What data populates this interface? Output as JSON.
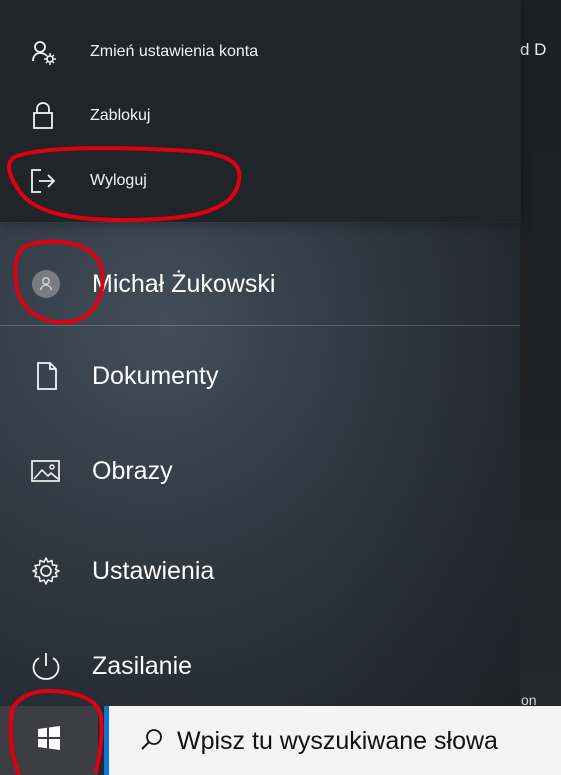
{
  "account_menu": {
    "items": [
      {
        "label": "Zmień ustawienia konta",
        "icon": "person-settings-icon"
      },
      {
        "label": "Zablokuj",
        "icon": "lock-icon"
      },
      {
        "label": "Wyloguj",
        "icon": "sign-out-icon"
      }
    ]
  },
  "fragments": {
    "top_right": "d D",
    "bottom_right": "on"
  },
  "start_menu": {
    "user": {
      "name": "Michał Żukowski",
      "icon": "avatar-icon"
    },
    "items": [
      {
        "label": "Dokumenty",
        "icon": "document-icon"
      },
      {
        "label": "Obrazy",
        "icon": "pictures-icon"
      },
      {
        "label": "Ustawienia",
        "icon": "settings-gear-icon"
      },
      {
        "label": "Zasilanie",
        "icon": "power-icon"
      }
    ]
  },
  "taskbar": {
    "start_button": {
      "icon": "windows-logo-icon"
    },
    "search": {
      "placeholder": "Wpisz tu wyszukiwane słowa",
      "icon": "search-icon"
    }
  },
  "annotations": {
    "color": "#e00010"
  }
}
